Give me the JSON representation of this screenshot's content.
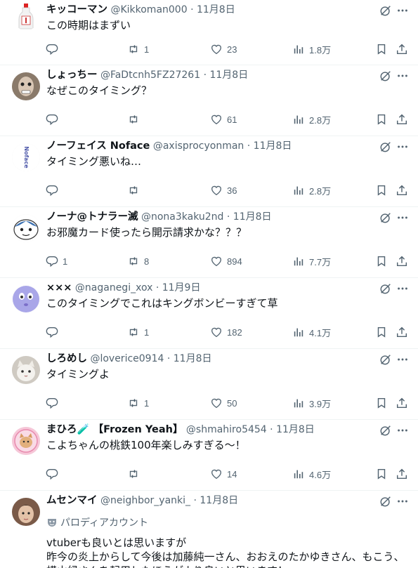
{
  "tweets": [
    {
      "name": "キッコーマン",
      "handle": "@Kikkoman000",
      "time": "11月8日",
      "text": "この時期はまずい",
      "replies": "",
      "retweets": "1",
      "likes": "23",
      "views": "1.8万",
      "avatar": "bottle"
    },
    {
      "name": "しょっちー",
      "handle": "@FaDtcnh5FZ27261",
      "time": "11月8日",
      "text": "なぜこのタイミング？",
      "replies": "",
      "retweets": "",
      "likes": "61",
      "views": "2.8万",
      "avatar": "face"
    },
    {
      "name": "ノーフェイス Noface",
      "handle": "@axisprocyonman",
      "time": "11月8日",
      "text": "タイミング悪いね…",
      "replies": "",
      "retweets": "",
      "likes": "36",
      "views": "2.8万",
      "avatar": "logo"
    },
    {
      "name": "ノーナ@トナラー滅",
      "handle": "@nona3kaku2nd",
      "time": "11月8日",
      "text": "お邪魔カード使ったら開示請求かな？？？",
      "replies": "1",
      "retweets": "8",
      "likes": "894",
      "views": "7.7万",
      "avatar": "character"
    },
    {
      "name": "×××",
      "handle": "@naganegi_xox",
      "time": "11月9日",
      "text": "このタイミングでこれはキングボンビーすぎて草",
      "replies": "",
      "retweets": "1",
      "likes": "182",
      "views": "4.1万",
      "avatar": "purple"
    },
    {
      "name": "しろめし",
      "handle": "@loverice0914",
      "time": "11月8日",
      "text": "タイミングよ",
      "replies": "",
      "retweets": "1",
      "likes": "50",
      "views": "3.9万",
      "avatar": "cat"
    },
    {
      "name": "まひろ🧪 【Frozen Yeah】",
      "handle": "@shmahiro5454",
      "time": "11月8日",
      "text": "こよちゃんの桃鉄100年楽しみすぎる～！",
      "replies": "",
      "retweets": "",
      "likes": "14",
      "views": "4.6万",
      "avatar": "pink"
    },
    {
      "name": "ムセンマイ",
      "handle": "@neighbor_yanki_",
      "time": "11月8日",
      "parody": "パロディアカウント",
      "text": "vtuberも良いとは思いますが\n昨今の炎上からして今後は加藤純一さん、おおえのたかゆきさん、もこう、\n横山緑さんを起用したほうがより良いと思います！",
      "avatar": "boy"
    }
  ],
  "colors": {
    "text": "#0f1419",
    "secondary": "#536471",
    "divider": "#eff3f4"
  },
  "icons": [
    "reply-icon",
    "retweet-icon",
    "like-icon",
    "views-icon",
    "bookmark-icon",
    "share-icon",
    "grok-icon",
    "more-icon",
    "parody-mask-icon"
  ]
}
